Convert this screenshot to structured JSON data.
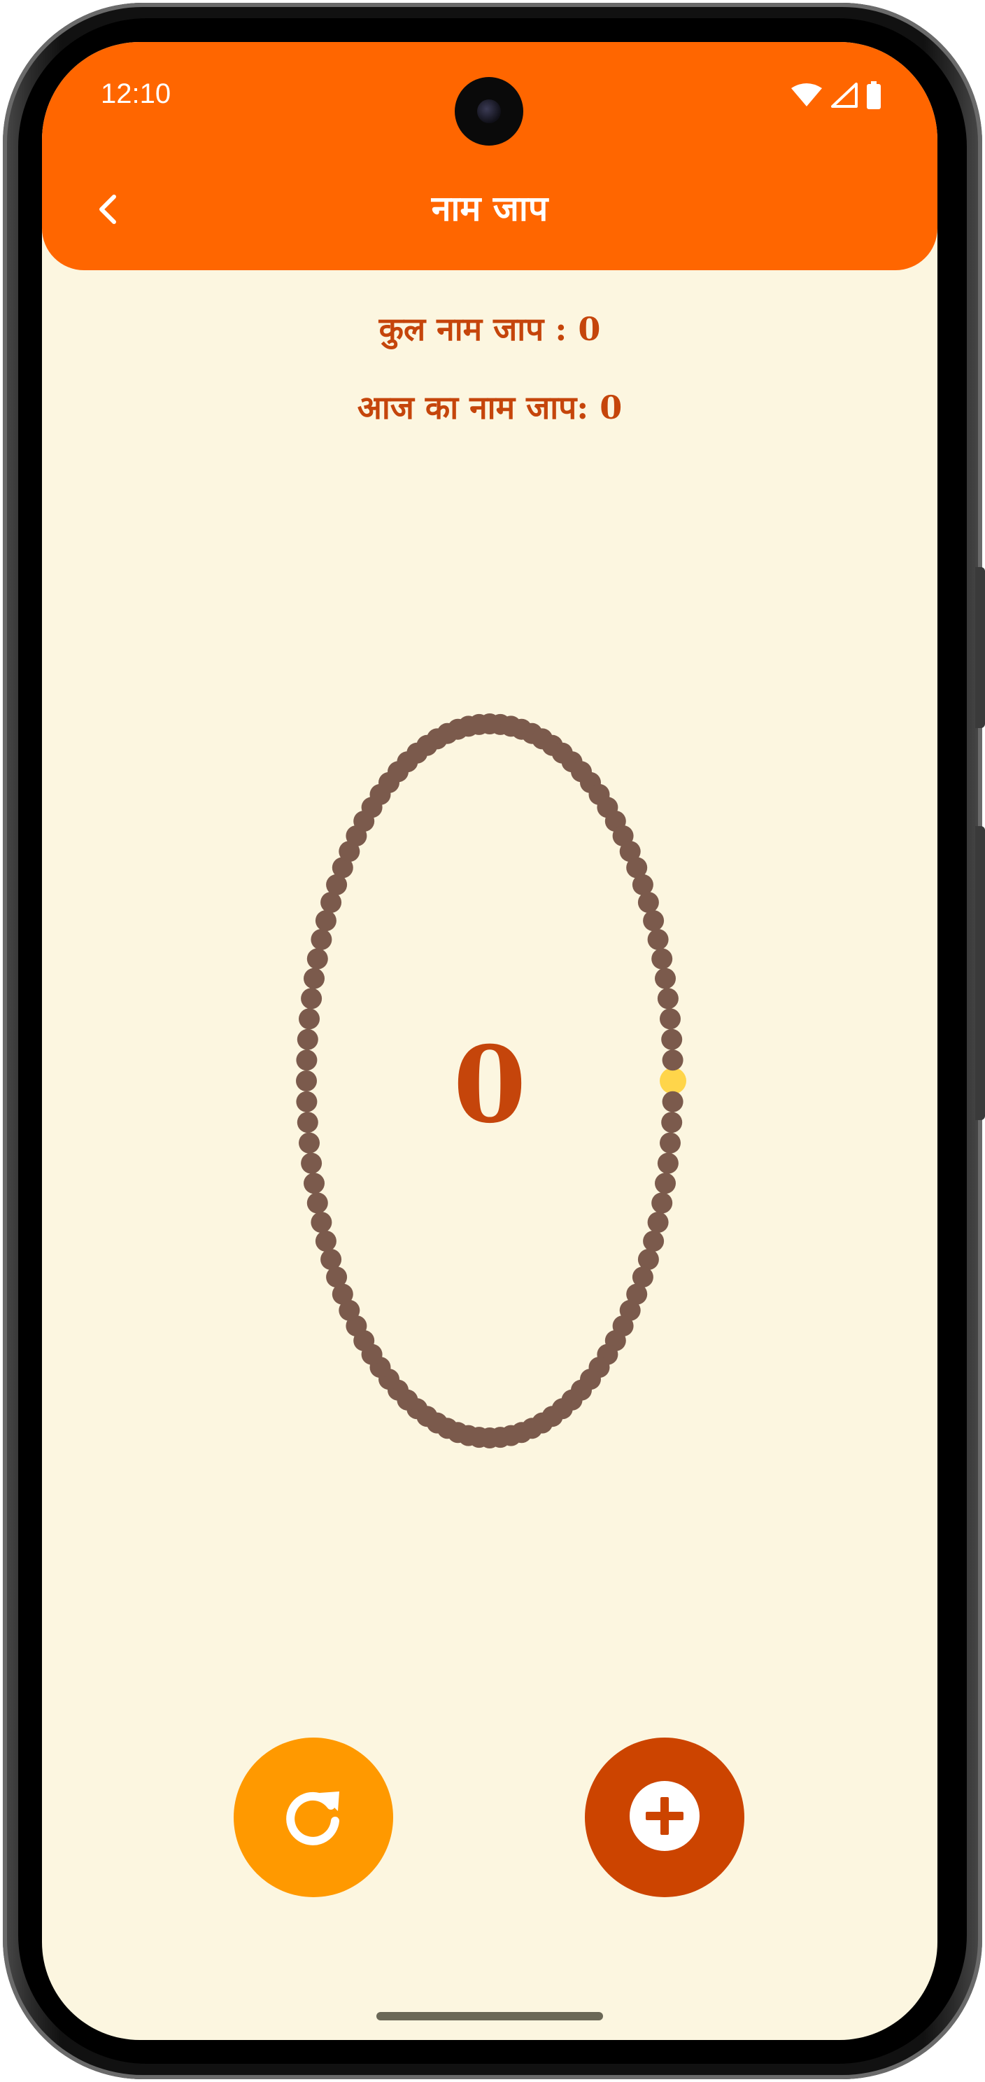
{
  "status_bar": {
    "time": "12:10",
    "icons": [
      "wifi-icon",
      "cellular-signal-icon",
      "battery-icon"
    ]
  },
  "app_bar": {
    "title": "नाम जाप",
    "back_icon": "chevron-left-icon",
    "color": "#ff6600"
  },
  "stats": {
    "total_label": "कुल नाम जाप : 0",
    "today_label": "आज का नाम जाप: 0"
  },
  "mala": {
    "count": "0",
    "beads_total": 108,
    "current_bead_index": 0,
    "bead_color": "#7b5a4c",
    "current_bead_color": "#ffd54a"
  },
  "actions": {
    "reset_icon": "refresh-icon",
    "add_icon": "plus-circle-icon",
    "reset_color": "#ff9900",
    "add_color": "#cc4400"
  },
  "colors": {
    "background": "#fcf6e0",
    "text_accent": "#c5450b"
  }
}
